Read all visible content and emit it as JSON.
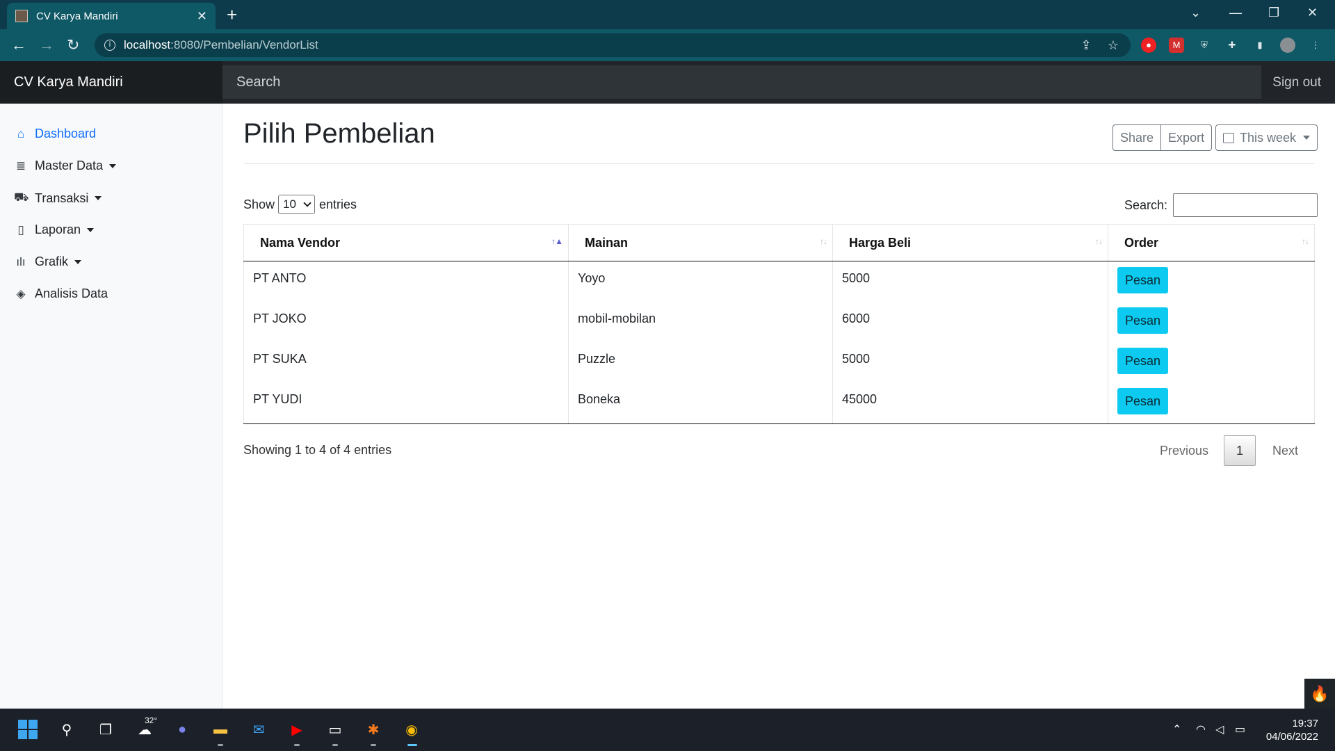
{
  "browser": {
    "tab_title": "CV Karya Mandiri",
    "url_host": "localhost",
    "url_path": ":8080/Pembelian/VendorList"
  },
  "navbar": {
    "brand": "CV Karya Mandiri",
    "search_placeholder": "Search",
    "signout": "Sign out"
  },
  "sidebar": {
    "items": [
      {
        "label": "Dashboard",
        "icon": "home-icon",
        "active": true
      },
      {
        "label": "Master Data",
        "icon": "database-icon",
        "dropdown": true
      },
      {
        "label": "Transaksi",
        "icon": "cart-icon",
        "dropdown": true
      },
      {
        "label": "Laporan",
        "icon": "clipboard-icon",
        "dropdown": true
      },
      {
        "label": "Grafik",
        "icon": "bar-chart-icon",
        "dropdown": true
      },
      {
        "label": "Analisis Data",
        "icon": "layers-icon"
      }
    ]
  },
  "main": {
    "title": "Pilih Pembelian",
    "share": "Share",
    "export": "Export",
    "period": "This week",
    "show_label": "Show",
    "entries_value": "10",
    "entries_label": "entries",
    "search_label": "Search:",
    "columns": [
      "Nama Vendor",
      "Mainan",
      "Harga Beli",
      "Order"
    ],
    "rows": [
      {
        "vendor": "PT ANTO",
        "mainan": "Yoyo",
        "harga": "5000",
        "order": "Pesan"
      },
      {
        "vendor": "PT JOKO",
        "mainan": "mobil-mobilan",
        "harga": "6000",
        "order": "Pesan"
      },
      {
        "vendor": "PT SUKA",
        "mainan": "Puzzle",
        "harga": "5000",
        "order": "Pesan"
      },
      {
        "vendor": "PT YUDI",
        "mainan": "Boneka",
        "harga": "45000",
        "order": "Pesan"
      }
    ],
    "info": "Showing 1 to 4 of 4 entries",
    "pager": {
      "previous": "Previous",
      "page": "1",
      "next": "Next"
    }
  },
  "taskbar": {
    "weather": "32°",
    "time": "19:37",
    "date": "04/06/2022"
  },
  "colors": {
    "chrome": "#0f5866",
    "navbar": "#212529",
    "link": "#0d6efd",
    "info_button": "#0dcaf0"
  }
}
